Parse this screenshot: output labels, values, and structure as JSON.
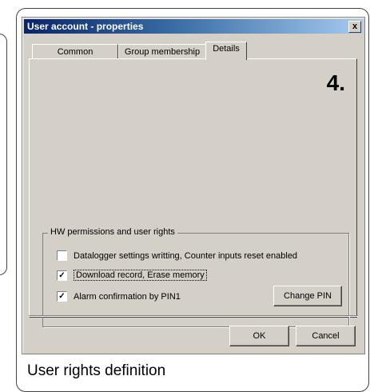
{
  "window": {
    "title": "User account - properties",
    "close_label": "x"
  },
  "tabs": [
    {
      "label": "Common"
    },
    {
      "label": "Group membership"
    },
    {
      "label": "Details"
    }
  ],
  "details": {
    "step_number": "4.",
    "group_title": "HW permissions and user rights",
    "permissions": [
      {
        "label": "Datalogger settings writting, Counter inputs reset enabled",
        "checked": false
      },
      {
        "label": "Download record, Erase memory",
        "checked": true
      },
      {
        "label": "Alarm confirmation by PIN1",
        "checked": true
      }
    ],
    "change_pin_label": "Change PIN"
  },
  "footer": {
    "ok_label": "OK",
    "cancel_label": "Cancel"
  },
  "caption": "User rights definition"
}
